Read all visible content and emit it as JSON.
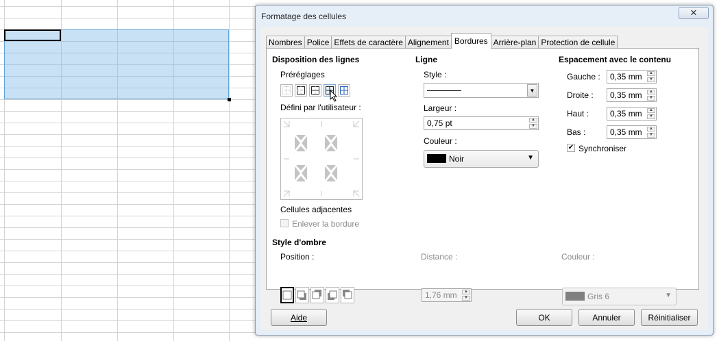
{
  "dialog": {
    "title": "Formatage des cellules",
    "close_glyph": "✕",
    "tabs": [
      {
        "label": "Nombres"
      },
      {
        "label": "Police"
      },
      {
        "label": "Effets de caractère"
      },
      {
        "label": "Alignement"
      },
      {
        "label": "Bordures",
        "active": true
      },
      {
        "label": "Arrière-plan"
      },
      {
        "label": "Protection de cellule"
      }
    ]
  },
  "line_arrangement": {
    "heading": "Disposition des lignes",
    "presets_label": "Préréglages",
    "presets": [
      "no-borders-icon",
      "outer-border-icon",
      "outer-horizontal-border-icon",
      "outer-inner-vertical-border-icon",
      "all-borders-icon"
    ],
    "user_defined_label": "Défini par l'utilisateur :",
    "adjacent_cells_label": "Cellules adjacentes",
    "remove_border_label": "Enlever la bordure"
  },
  "line": {
    "heading": "Ligne",
    "style_label": "Style :",
    "width_label": "Largeur :",
    "width_value": "0,75 pt",
    "color_label": "Couleur :",
    "color_value": "Noir",
    "color_swatch": "#000000"
  },
  "spacing": {
    "heading": "Espacement avec le contenu",
    "left_label": "Gauche :",
    "left_value": "0,35 mm",
    "right_label": "Droite :",
    "right_value": "0,35 mm",
    "top_label": "Haut :",
    "top_value": "0,35 mm",
    "bottom_label": "Bas :",
    "bottom_value": "0,35 mm",
    "sync_label": "Synchroniser",
    "sync_checked": true
  },
  "shadow": {
    "heading": "Style d'ombre",
    "position_label": "Position :",
    "distance_label": "Distance :",
    "distance_value": "1,76 mm",
    "color_label": "Couleur :",
    "color_value": "Gris 6",
    "color_swatch": "#808080"
  },
  "buttons": {
    "help": "Aide",
    "ok": "OK",
    "cancel": "Annuler",
    "reset": "Réinitialiser"
  }
}
